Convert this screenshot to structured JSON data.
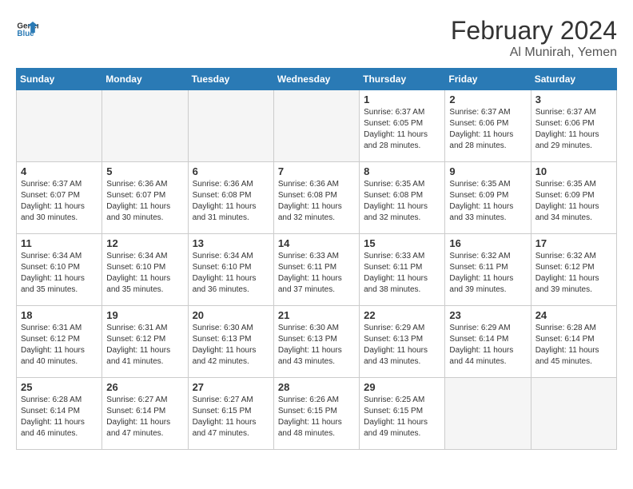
{
  "header": {
    "logo_line1": "General",
    "logo_line2": "Blue",
    "month_year": "February 2024",
    "location": "Al Munirah, Yemen"
  },
  "weekdays": [
    "Sunday",
    "Monday",
    "Tuesday",
    "Wednesday",
    "Thursday",
    "Friday",
    "Saturday"
  ],
  "weeks": [
    [
      {
        "day": "",
        "info": ""
      },
      {
        "day": "",
        "info": ""
      },
      {
        "day": "",
        "info": ""
      },
      {
        "day": "",
        "info": ""
      },
      {
        "day": "1",
        "info": "Sunrise: 6:37 AM\nSunset: 6:05 PM\nDaylight: 11 hours\nand 28 minutes."
      },
      {
        "day": "2",
        "info": "Sunrise: 6:37 AM\nSunset: 6:06 PM\nDaylight: 11 hours\nand 28 minutes."
      },
      {
        "day": "3",
        "info": "Sunrise: 6:37 AM\nSunset: 6:06 PM\nDaylight: 11 hours\nand 29 minutes."
      }
    ],
    [
      {
        "day": "4",
        "info": "Sunrise: 6:37 AM\nSunset: 6:07 PM\nDaylight: 11 hours\nand 30 minutes."
      },
      {
        "day": "5",
        "info": "Sunrise: 6:36 AM\nSunset: 6:07 PM\nDaylight: 11 hours\nand 30 minutes."
      },
      {
        "day": "6",
        "info": "Sunrise: 6:36 AM\nSunset: 6:08 PM\nDaylight: 11 hours\nand 31 minutes."
      },
      {
        "day": "7",
        "info": "Sunrise: 6:36 AM\nSunset: 6:08 PM\nDaylight: 11 hours\nand 32 minutes."
      },
      {
        "day": "8",
        "info": "Sunrise: 6:35 AM\nSunset: 6:08 PM\nDaylight: 11 hours\nand 32 minutes."
      },
      {
        "day": "9",
        "info": "Sunrise: 6:35 AM\nSunset: 6:09 PM\nDaylight: 11 hours\nand 33 minutes."
      },
      {
        "day": "10",
        "info": "Sunrise: 6:35 AM\nSunset: 6:09 PM\nDaylight: 11 hours\nand 34 minutes."
      }
    ],
    [
      {
        "day": "11",
        "info": "Sunrise: 6:34 AM\nSunset: 6:10 PM\nDaylight: 11 hours\nand 35 minutes."
      },
      {
        "day": "12",
        "info": "Sunrise: 6:34 AM\nSunset: 6:10 PM\nDaylight: 11 hours\nand 35 minutes."
      },
      {
        "day": "13",
        "info": "Sunrise: 6:34 AM\nSunset: 6:10 PM\nDaylight: 11 hours\nand 36 minutes."
      },
      {
        "day": "14",
        "info": "Sunrise: 6:33 AM\nSunset: 6:11 PM\nDaylight: 11 hours\nand 37 minutes."
      },
      {
        "day": "15",
        "info": "Sunrise: 6:33 AM\nSunset: 6:11 PM\nDaylight: 11 hours\nand 38 minutes."
      },
      {
        "day": "16",
        "info": "Sunrise: 6:32 AM\nSunset: 6:11 PM\nDaylight: 11 hours\nand 39 minutes."
      },
      {
        "day": "17",
        "info": "Sunrise: 6:32 AM\nSunset: 6:12 PM\nDaylight: 11 hours\nand 39 minutes."
      }
    ],
    [
      {
        "day": "18",
        "info": "Sunrise: 6:31 AM\nSunset: 6:12 PM\nDaylight: 11 hours\nand 40 minutes."
      },
      {
        "day": "19",
        "info": "Sunrise: 6:31 AM\nSunset: 6:12 PM\nDaylight: 11 hours\nand 41 minutes."
      },
      {
        "day": "20",
        "info": "Sunrise: 6:30 AM\nSunset: 6:13 PM\nDaylight: 11 hours\nand 42 minutes."
      },
      {
        "day": "21",
        "info": "Sunrise: 6:30 AM\nSunset: 6:13 PM\nDaylight: 11 hours\nand 43 minutes."
      },
      {
        "day": "22",
        "info": "Sunrise: 6:29 AM\nSunset: 6:13 PM\nDaylight: 11 hours\nand 43 minutes."
      },
      {
        "day": "23",
        "info": "Sunrise: 6:29 AM\nSunset: 6:14 PM\nDaylight: 11 hours\nand 44 minutes."
      },
      {
        "day": "24",
        "info": "Sunrise: 6:28 AM\nSunset: 6:14 PM\nDaylight: 11 hours\nand 45 minutes."
      }
    ],
    [
      {
        "day": "25",
        "info": "Sunrise: 6:28 AM\nSunset: 6:14 PM\nDaylight: 11 hours\nand 46 minutes."
      },
      {
        "day": "26",
        "info": "Sunrise: 6:27 AM\nSunset: 6:14 PM\nDaylight: 11 hours\nand 47 minutes."
      },
      {
        "day": "27",
        "info": "Sunrise: 6:27 AM\nSunset: 6:15 PM\nDaylight: 11 hours\nand 47 minutes."
      },
      {
        "day": "28",
        "info": "Sunrise: 6:26 AM\nSunset: 6:15 PM\nDaylight: 11 hours\nand 48 minutes."
      },
      {
        "day": "29",
        "info": "Sunrise: 6:25 AM\nSunset: 6:15 PM\nDaylight: 11 hours\nand 49 minutes."
      },
      {
        "day": "",
        "info": ""
      },
      {
        "day": "",
        "info": ""
      }
    ]
  ]
}
